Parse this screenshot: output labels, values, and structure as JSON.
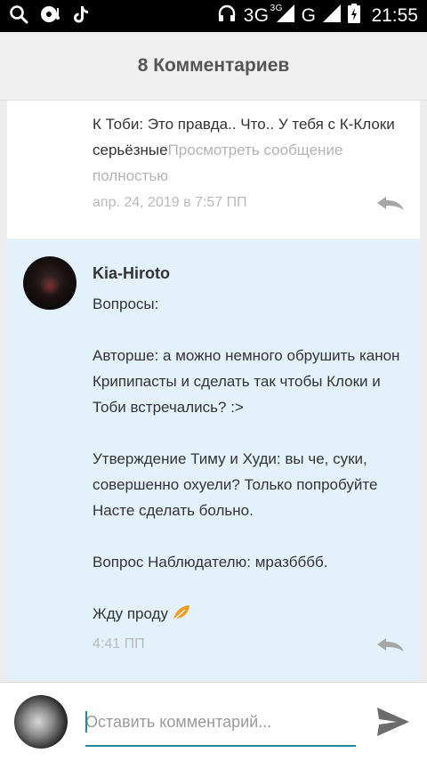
{
  "status_bar": {
    "network_label": "3G",
    "network_super": "3G",
    "network2_label": "G",
    "time": "21:55"
  },
  "header": {
    "title": "8 Комментариев"
  },
  "comments": [
    {
      "text": "К Тоби: Это правда.. Что.. У тебя с К-Клоки серьёзные",
      "more": "Просмотреть сообщение полностью",
      "timestamp": "апр. 24, 2019 в 7:57 ПП"
    },
    {
      "author": "Kia-Hiroto",
      "lines": [
        "Вопросы:",
        "",
        "Авторше: а можно немного обрушить канон Крипипасты и сделать так чтобы Клоки и Тоби встречались? :>",
        "",
        "Утверждение Тиму и Худи: вы че, суки, совершенно охуели? Только попробуйте Насте сделать больно.",
        "",
        "Вопрос Наблюдателю: мразбббб.",
        "",
        "Жду проду"
      ],
      "timestamp": "4:41 ПП"
    }
  ],
  "composer": {
    "placeholder": "Оставить комментарий..."
  },
  "colors": {
    "accent": "#1e8c96",
    "highlight_bg": "#e3f2fa"
  }
}
